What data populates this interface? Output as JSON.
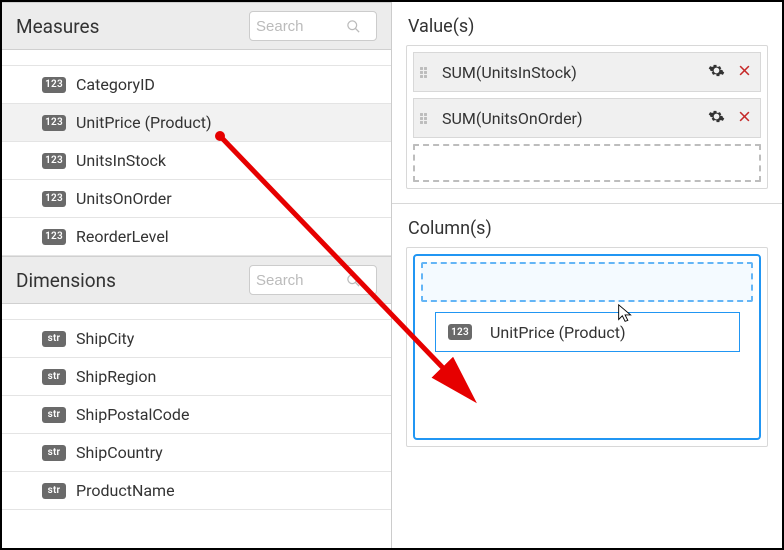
{
  "left": {
    "measures": {
      "title": "Measures",
      "search_placeholder": "Search",
      "items": [
        {
          "badge": "123",
          "label": "CategoryID"
        },
        {
          "badge": "123",
          "label": "UnitPrice (Product)",
          "hover": true
        },
        {
          "badge": "123",
          "label": "UnitsInStock"
        },
        {
          "badge": "123",
          "label": "UnitsOnOrder"
        },
        {
          "badge": "123",
          "label": "ReorderLevel"
        }
      ]
    },
    "dimensions": {
      "title": "Dimensions",
      "search_placeholder": "Search",
      "items": [
        {
          "badge": "str",
          "label": "ShipCity"
        },
        {
          "badge": "str",
          "label": "ShipRegion"
        },
        {
          "badge": "str",
          "label": "ShipPostalCode"
        },
        {
          "badge": "str",
          "label": "ShipCountry"
        },
        {
          "badge": "str",
          "label": "ProductName"
        }
      ]
    }
  },
  "right": {
    "values": {
      "title": "Value(s)",
      "pills": [
        {
          "label": "SUM(UnitsInStock)"
        },
        {
          "label": "SUM(UnitsOnOrder)"
        }
      ]
    },
    "columns": {
      "title": "Column(s)",
      "drag_item": {
        "badge": "123",
        "label": "UnitPrice (Product)"
      }
    }
  }
}
